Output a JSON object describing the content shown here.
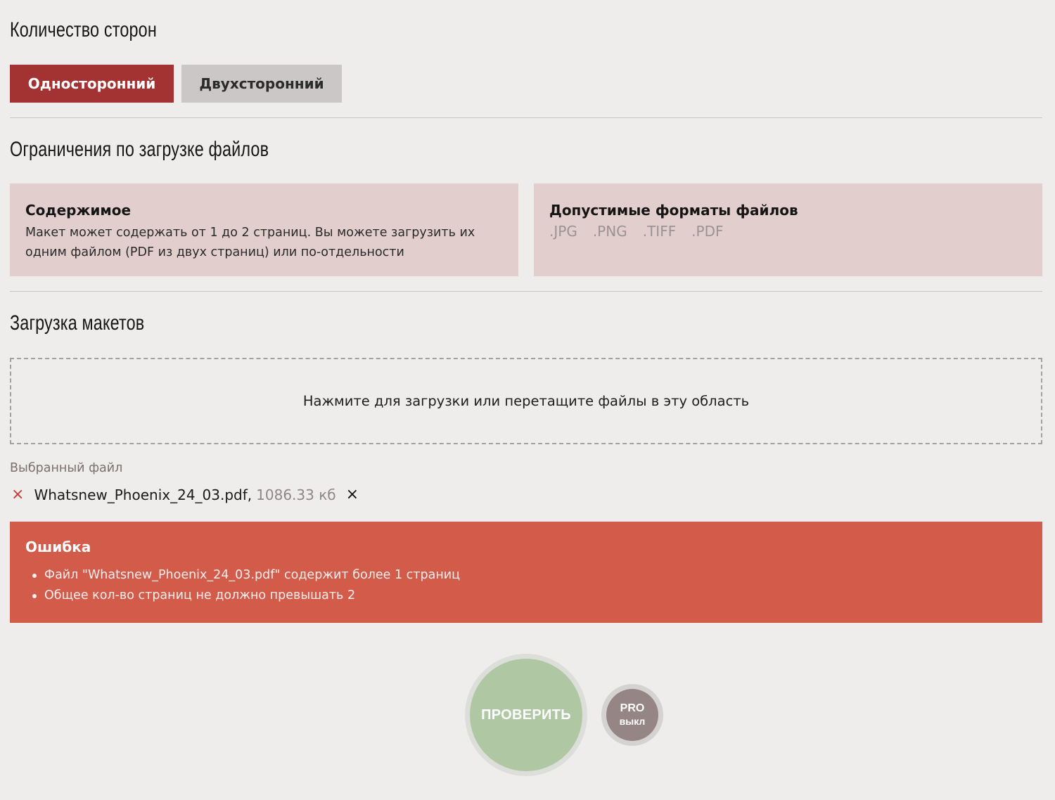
{
  "sides": {
    "title": "Количество сторон",
    "options": [
      "Односторонний",
      "Двухсторонний"
    ],
    "selected": "Односторонний"
  },
  "limits": {
    "title": "Ограничения по загрузке файлов",
    "content_card": {
      "title": "Содержимое",
      "text": "Макет может содержать от 1 до 2 страниц. Вы можете загрузить их одним файлом (PDF из двух страниц) или по-отдельности"
    },
    "formats_card": {
      "title": "Допустимые форматы файлов",
      "formats": [
        ".JPG",
        ".PNG",
        ".TIFF",
        ".PDF"
      ]
    }
  },
  "upload": {
    "title": "Загрузка макетов",
    "dropzone_text": "Нажмите для загрузки или перетащите файлы в эту область",
    "selected_label": "Выбранный файл",
    "file": {
      "name": "Whatsnew_Phoenix_24_03.pdf,",
      "size": "1086.33 кб",
      "remove_icon": "×",
      "close_icon": "×"
    }
  },
  "error": {
    "title": "Ошибка",
    "items": [
      "Файл \"Whatsnew_Phoenix_24_03.pdf\" содержит более 1 страниц",
      "Общее кол-во страниц не должно превышать 2"
    ]
  },
  "actions": {
    "check_label": "ПРОВЕРИТЬ",
    "pro_top": "PRO",
    "pro_bottom": "выкл"
  },
  "colors": {
    "accent": "#a33332",
    "error_bg": "#d35b4a",
    "card_bg": "#e2cfcd",
    "check_green": "#afc7a3",
    "pro_gray": "#958584"
  }
}
